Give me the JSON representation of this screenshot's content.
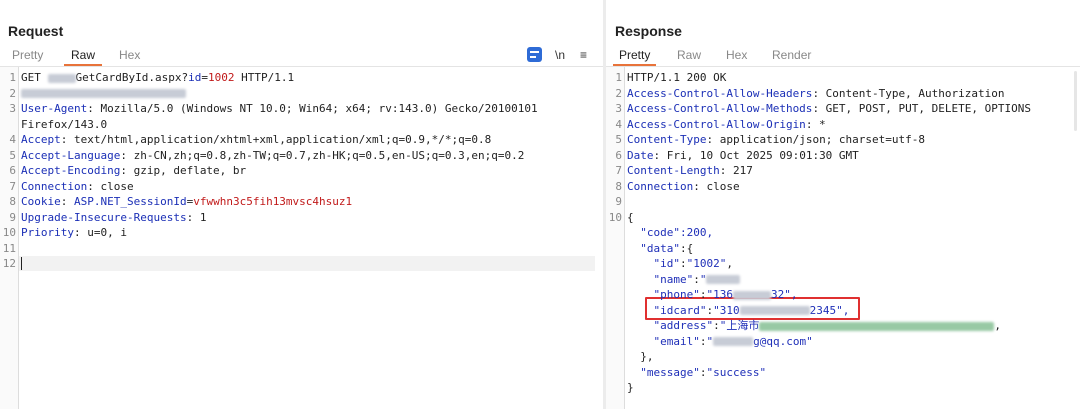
{
  "request": {
    "title": "Request",
    "tabs": [
      "Pretty",
      "Raw",
      "Hex"
    ],
    "active_tab": "Raw",
    "tools": {
      "wrap_icon": "wrap-lines-icon",
      "newline": "\\n",
      "menu": "≡"
    },
    "lines": [
      {
        "n": "1",
        "parts": [
          {
            "t": "GET ",
            "c": "v"
          },
          {
            "blur": 28
          },
          {
            "t": "GetCardById.aspx?",
            "c": "v"
          },
          {
            "t": "id",
            "c": "k"
          },
          {
            "t": "=",
            "c": "v"
          },
          {
            "t": "1002",
            "c": "red"
          },
          {
            "t": " HTTP/1.1",
            "c": "v"
          }
        ]
      },
      {
        "n": "2",
        "parts": [
          {
            "blur": 165
          }
        ]
      },
      {
        "n": "3",
        "parts": [
          {
            "t": "User-Agent",
            "c": "k"
          },
          {
            "t": ": Mozilla/5.0 (Windows NT 10.0; Win64; x64; rv:143.0) Gecko/20100101",
            "c": "v"
          }
        ]
      },
      {
        "n": "",
        "parts": [
          {
            "t": "Firefox/143.0",
            "c": "v"
          }
        ]
      },
      {
        "n": "4",
        "parts": [
          {
            "t": "Accept",
            "c": "k"
          },
          {
            "t": ": text/html,application/xhtml+xml,application/xml;q=0.9,*/*;q=0.8",
            "c": "v"
          }
        ]
      },
      {
        "n": "5",
        "parts": [
          {
            "t": "Accept-Language",
            "c": "k"
          },
          {
            "t": ": zh-CN,zh;q=0.8,zh-TW;q=0.7,zh-HK;q=0.5,en-US;q=0.3,en;q=0.2",
            "c": "v"
          }
        ]
      },
      {
        "n": "6",
        "parts": [
          {
            "t": "Accept-Encoding",
            "c": "k"
          },
          {
            "t": ": gzip, deflate, br",
            "c": "v"
          }
        ]
      },
      {
        "n": "7",
        "parts": [
          {
            "t": "Connection",
            "c": "k"
          },
          {
            "t": ": close",
            "c": "v"
          }
        ]
      },
      {
        "n": "8",
        "parts": [
          {
            "t": "Cookie",
            "c": "k"
          },
          {
            "t": ": ",
            "c": "v"
          },
          {
            "t": "ASP.NET_SessionId",
            "c": "k"
          },
          {
            "t": "=",
            "c": "v"
          },
          {
            "t": "vfwwhn3c5fih13mvsc4hsuz1",
            "c": "red"
          }
        ]
      },
      {
        "n": "9",
        "parts": [
          {
            "t": "Upgrade-Insecure-Requests",
            "c": "k"
          },
          {
            "t": ": 1",
            "c": "v"
          }
        ]
      },
      {
        "n": "10",
        "parts": [
          {
            "t": "Priority",
            "c": "k"
          },
          {
            "t": ": u=0, i",
            "c": "v"
          }
        ]
      },
      {
        "n": "11",
        "parts": []
      },
      {
        "n": "12",
        "parts": []
      }
    ]
  },
  "response": {
    "title": "Response",
    "tabs": [
      "Pretty",
      "Raw",
      "Hex",
      "Render"
    ],
    "active_tab": "Pretty",
    "lines": [
      {
        "n": "1",
        "parts": [
          {
            "t": "HTTP/1.1 200 OK",
            "c": "v"
          }
        ]
      },
      {
        "n": "2",
        "parts": [
          {
            "t": "Access-Control-Allow-Headers",
            "c": "k"
          },
          {
            "t": ": Content-Type, Authorization",
            "c": "v"
          }
        ]
      },
      {
        "n": "3",
        "parts": [
          {
            "t": "Access-Control-Allow-Methods",
            "c": "k"
          },
          {
            "t": ": GET, POST, PUT, DELETE, OPTIONS",
            "c": "v"
          }
        ]
      },
      {
        "n": "4",
        "parts": [
          {
            "t": "Access-Control-Allow-Origin",
            "c": "k"
          },
          {
            "t": ": *",
            "c": "v"
          }
        ]
      },
      {
        "n": "5",
        "parts": [
          {
            "t": "Content-Type",
            "c": "k"
          },
          {
            "t": ": application/json; charset=utf-8",
            "c": "v"
          }
        ]
      },
      {
        "n": "6",
        "parts": [
          {
            "t": "Date",
            "c": "k"
          },
          {
            "t": ": Fri, 10 Oct 2025 09:01:30 GMT",
            "c": "v"
          }
        ]
      },
      {
        "n": "7",
        "parts": [
          {
            "t": "Content-Length",
            "c": "k"
          },
          {
            "t": ": 217",
            "c": "v"
          }
        ]
      },
      {
        "n": "8",
        "parts": [
          {
            "t": "Connection",
            "c": "k"
          },
          {
            "t": ": close",
            "c": "v"
          }
        ]
      },
      {
        "n": "9",
        "parts": []
      },
      {
        "n": "10",
        "parts": [
          {
            "t": "{",
            "c": "v"
          }
        ]
      },
      {
        "n": "",
        "parts": [
          {
            "t": "  \"code\"",
            "c": "s"
          },
          {
            "t": ":200,",
            "c": "blue"
          }
        ]
      },
      {
        "n": "",
        "parts": [
          {
            "t": "  \"data\"",
            "c": "s"
          },
          {
            "t": ":{",
            "c": "v"
          }
        ]
      },
      {
        "n": "",
        "parts": [
          {
            "t": "    \"id\"",
            "c": "s"
          },
          {
            "t": ":",
            "c": "v"
          },
          {
            "t": "\"1002\"",
            "c": "s"
          },
          {
            "t": ",",
            "c": "v"
          }
        ]
      },
      {
        "n": "",
        "parts": [
          {
            "t": "    \"name\"",
            "c": "s"
          },
          {
            "t": ":",
            "c": "v"
          },
          {
            "t": "\"",
            "c": "s"
          },
          {
            "blur": 34
          }
        ]
      },
      {
        "n": "",
        "parts": [
          {
            "t": "    \"phone\"",
            "c": "s"
          },
          {
            "t": ":",
            "c": "v"
          },
          {
            "t": "\"136",
            "c": "s"
          },
          {
            "blur": 38
          },
          {
            "t": "32\",",
            "c": "s"
          }
        ]
      },
      {
        "n": "",
        "parts": [
          {
            "t": "    \"idcard\"",
            "c": "s"
          },
          {
            "t": ":",
            "c": "v"
          },
          {
            "t": "\"310",
            "c": "s"
          },
          {
            "blur": 70
          },
          {
            "t": "2345\",",
            "c": "s"
          }
        ]
      },
      {
        "n": "",
        "parts": [
          {
            "t": "    \"address\"",
            "c": "s"
          },
          {
            "t": ":",
            "c": "v"
          },
          {
            "t": "\"上海市",
            "c": "s"
          },
          {
            "blur": 235,
            "green": true
          },
          {
            "t": ",",
            "c": "v"
          }
        ]
      },
      {
        "n": "",
        "parts": [
          {
            "t": "    \"email\"",
            "c": "s"
          },
          {
            "t": ":",
            "c": "v"
          },
          {
            "t": "\"",
            "c": "s"
          },
          {
            "blur": 40
          },
          {
            "t": "g@qq.com\"",
            "c": "s"
          }
        ]
      },
      {
        "n": "",
        "parts": [
          {
            "t": "  },",
            "c": "v"
          }
        ]
      },
      {
        "n": "",
        "parts": [
          {
            "t": "  \"message\"",
            "c": "s"
          },
          {
            "t": ":",
            "c": "v"
          },
          {
            "t": "\"success\"",
            "c": "s"
          }
        ]
      },
      {
        "n": "",
        "parts": [
          {
            "t": "}",
            "c": "v"
          }
        ]
      }
    ]
  },
  "colors": {
    "accent": "#e8733a",
    "key": "#1b2fb6",
    "value_red": "#c11a1a",
    "highlight": "#e03030"
  }
}
